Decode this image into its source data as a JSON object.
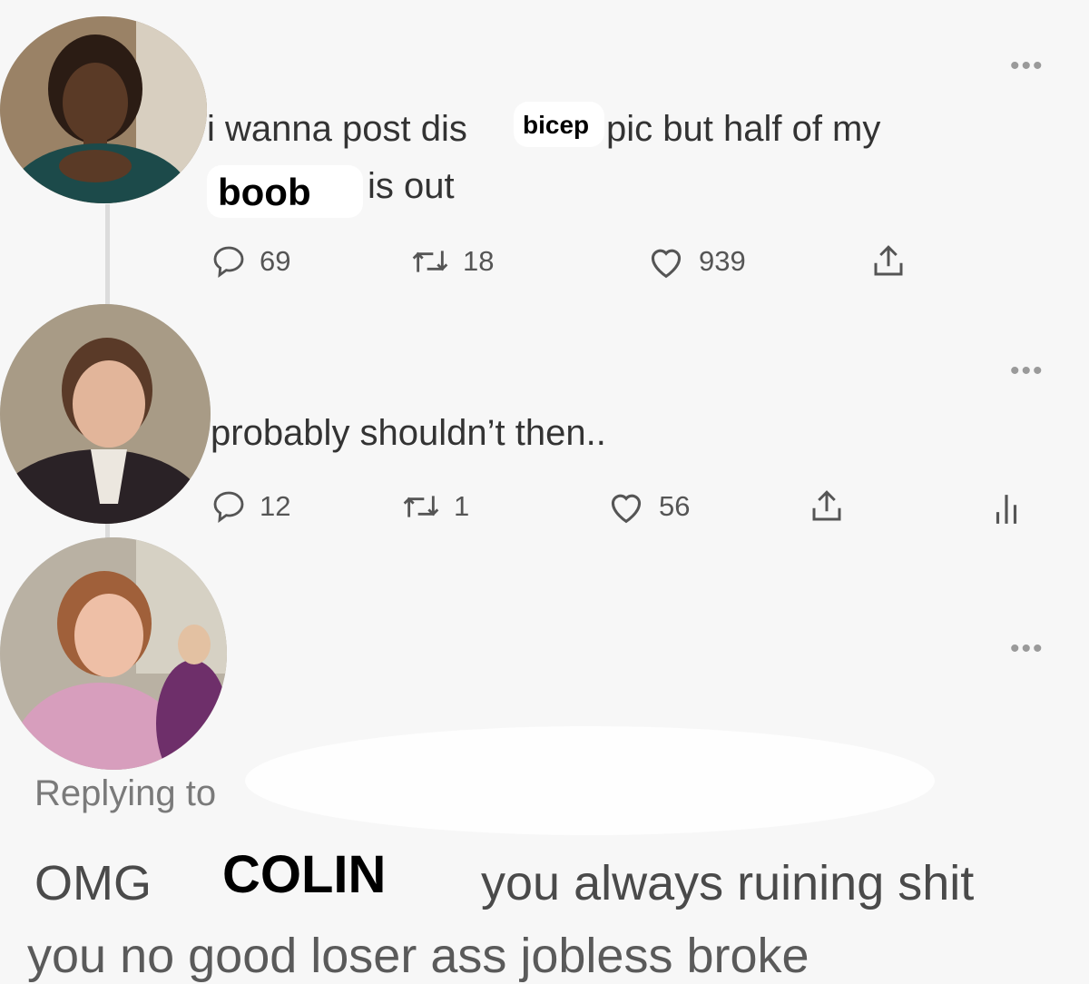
{
  "tweets": [
    {
      "line1_prefix": "i wanna post dis",
      "line1_overlay": "bicep",
      "line1_suffix": "pic but half of my",
      "line2_overlay": "boob",
      "line2_suffix": "is out",
      "replies": "69",
      "retweets": "18",
      "likes": "939"
    },
    {
      "text": "probably shouldn’t then..",
      "replies": "12",
      "retweets": "1",
      "likes": "56"
    }
  ],
  "reply": {
    "replying_to": "Replying to",
    "prefix": "OMG",
    "name_overlay": "COLIN",
    "suffix": "you always ruining shit",
    "cut_line": "you no good loser ass jobless broke"
  },
  "icons": {
    "more": "more-icon",
    "reply": "reply-icon",
    "retweet": "retweet-icon",
    "like": "heart-icon",
    "share": "share-icon",
    "analytics": "analytics-icon"
  },
  "colors": {
    "background": "#f7f7f7",
    "text": "#333333",
    "muted": "#7a7a7a"
  }
}
